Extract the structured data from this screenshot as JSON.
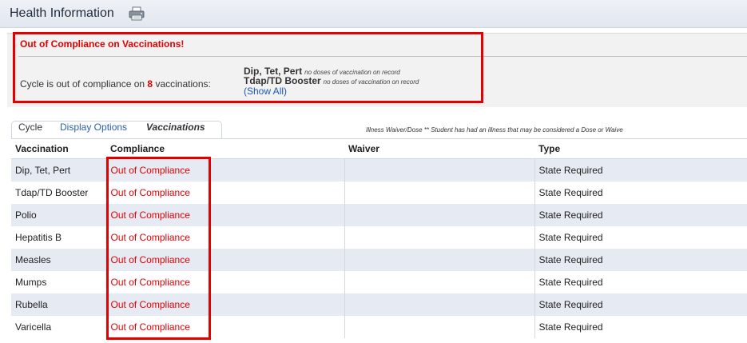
{
  "header": {
    "title": "Health Information",
    "print_icon": "printer-icon"
  },
  "alert": {
    "title": "Out of Compliance on Vaccinations!",
    "cycle_prefix": "Cycle is out of compliance on",
    "count": "8",
    "cycle_suffix": "vaccinations:",
    "items": [
      {
        "name": "Dip, Tet, Pert",
        "note": "no doses of vaccination on record"
      },
      {
        "name": "Tdap/TD Booster",
        "note": "no doses of vaccination on record"
      }
    ],
    "show_all": "(Show All)"
  },
  "tabs": {
    "cycle": "Cycle",
    "display_options": "Display Options",
    "vaccinations": "Vaccinations"
  },
  "illness_note": "Illness Waiver/Dose ** Student has had an illness that may be considered a Dose or Waive",
  "table": {
    "headers": [
      "Vaccination",
      "Compliance",
      "Waiver",
      "Type"
    ],
    "rows": [
      {
        "vaccination": "Dip, Tet, Pert",
        "compliance": "Out of Compliance",
        "waiver": "",
        "type": "State Required"
      },
      {
        "vaccination": "Tdap/TD Booster",
        "compliance": "Out of Compliance",
        "waiver": "",
        "type": "State Required"
      },
      {
        "vaccination": "Polio",
        "compliance": "Out of Compliance",
        "waiver": "",
        "type": "State Required"
      },
      {
        "vaccination": "Hepatitis B",
        "compliance": "Out of Compliance",
        "waiver": "",
        "type": "State Required"
      },
      {
        "vaccination": "Measles",
        "compliance": "Out of Compliance",
        "waiver": "",
        "type": "State Required"
      },
      {
        "vaccination": "Mumps",
        "compliance": "Out of Compliance",
        "waiver": "",
        "type": "State Required"
      },
      {
        "vaccination": "Rubella",
        "compliance": "Out of Compliance",
        "waiver": "",
        "type": "State Required"
      },
      {
        "vaccination": "Varicella",
        "compliance": "Out of Compliance",
        "waiver": "",
        "type": "State Required"
      }
    ]
  },
  "colors": {
    "alert_red": "#e30000",
    "link_blue": "#2b60b0",
    "row_alt": "#e6eaf2"
  }
}
